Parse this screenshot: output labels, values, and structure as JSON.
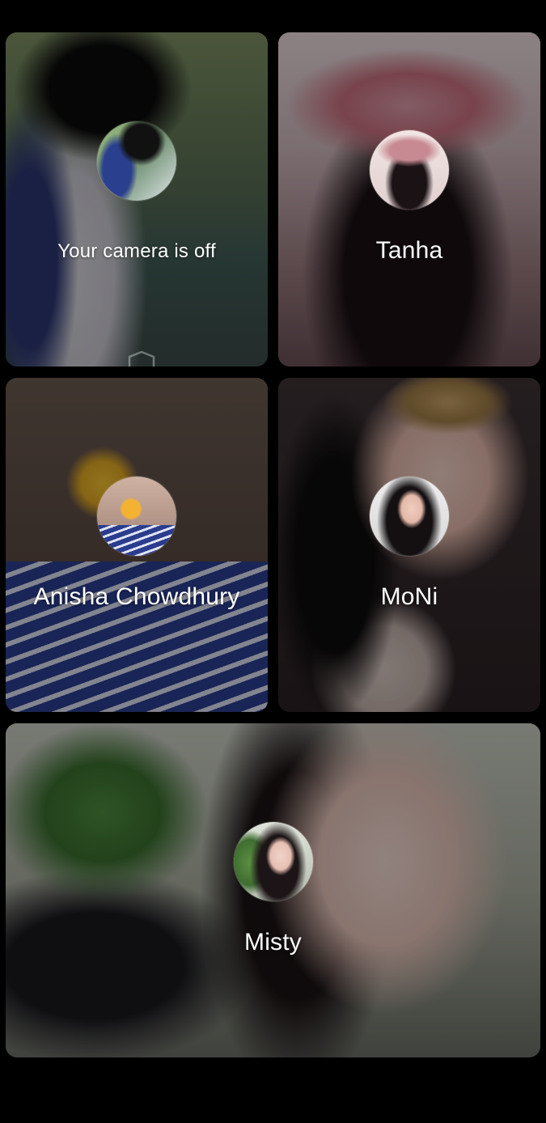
{
  "tiles": [
    {
      "id": "self",
      "label": "Your camera is off",
      "camera_off": true,
      "icon": "shield-icon"
    },
    {
      "id": "tanha",
      "label": "Tanha"
    },
    {
      "id": "anisha",
      "label": "Anisha Chowdhury"
    },
    {
      "id": "moni",
      "label": "MoNi"
    },
    {
      "id": "misty",
      "label": "Misty"
    }
  ],
  "colors": {
    "background": "#000000",
    "label_text": "#ffffff",
    "tile_dim_overlay": "rgba(0,0,0,0.40)"
  }
}
